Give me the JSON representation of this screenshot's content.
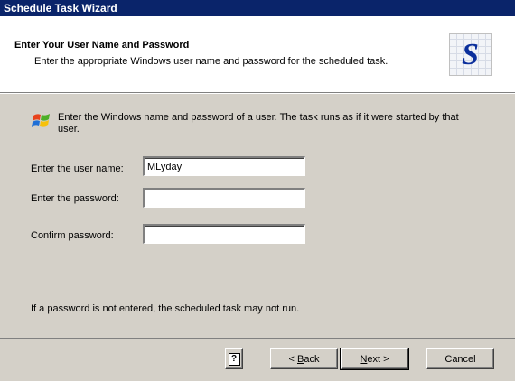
{
  "window": {
    "title": "Schedule Task Wizard"
  },
  "header": {
    "title": "Enter Your User Name and Password",
    "subtitle": "Enter the appropriate Windows user name and password for the scheduled task.",
    "logo_letter": "S"
  },
  "body": {
    "intro": "Enter the Windows name and password of a user. The task runs as if it were started by that user.",
    "user_label": "Enter the user name:",
    "user_value": "MLyday",
    "password_label": "Enter the password:",
    "password_value": "",
    "confirm_label": "Confirm password:",
    "confirm_value": "",
    "note": "If a password is not entered, the scheduled task may not run."
  },
  "buttons": {
    "help_glyph": "?",
    "back_mnemonic": "B",
    "back_rest": "ack",
    "back_prefix": "< ",
    "next_mnemonic": "N",
    "next_rest": "ext",
    "next_suffix": " >",
    "cancel": "Cancel"
  },
  "colors": {
    "titlebar": "#0a246a",
    "dialog_face": "#d4d0c8",
    "header_bg": "#ffffff"
  }
}
